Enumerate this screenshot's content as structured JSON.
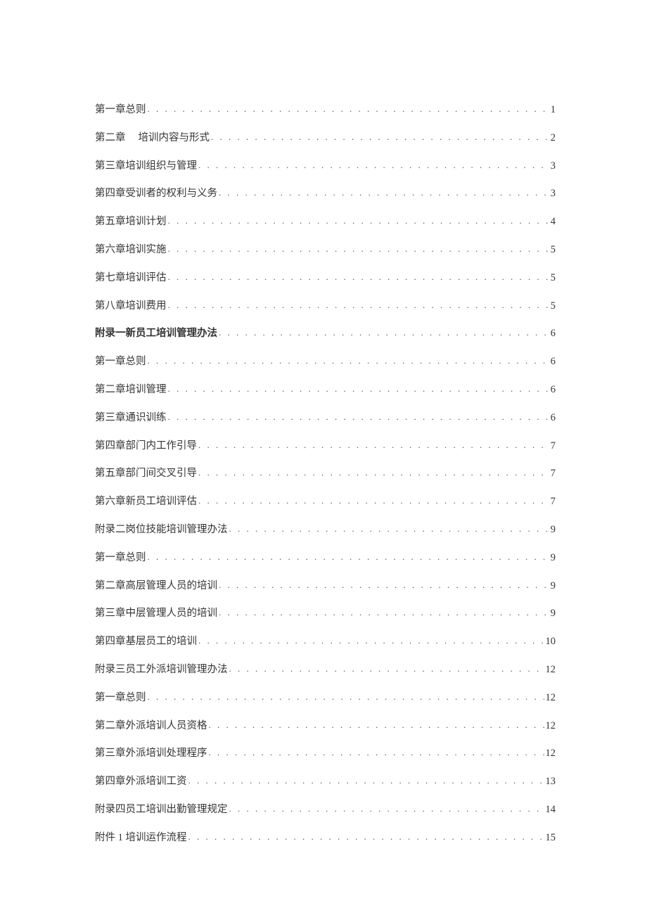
{
  "toc": [
    {
      "title": "第一章总则",
      "page": "1",
      "bold": false,
      "hasSpacer": false
    },
    {
      "title": "第二章",
      "titleSuffix": "培训内容与形式",
      "page": "2",
      "bold": false,
      "hasSpacer": true
    },
    {
      "title": "第三章培训组织与管理",
      "page": "3",
      "bold": false,
      "hasSpacer": false
    },
    {
      "title": "第四章受训者的权利与义务",
      "page": "3",
      "bold": false,
      "hasSpacer": false
    },
    {
      "title": "第五章培训计划",
      "page": "4",
      "bold": false,
      "hasSpacer": false
    },
    {
      "title": "第六章培训实施",
      "page": "5",
      "bold": false,
      "hasSpacer": false
    },
    {
      "title": "第七章培训评估",
      "page": "5",
      "bold": false,
      "hasSpacer": false
    },
    {
      "title": "第八章培训费用",
      "page": "5",
      "bold": false,
      "hasSpacer": false
    },
    {
      "title": "附录一新员工培训管理办法",
      "page": "6",
      "bold": true,
      "hasSpacer": false
    },
    {
      "title": "第一章总则",
      "page": "6",
      "bold": false,
      "hasSpacer": false
    },
    {
      "title": "第二章培训管理",
      "page": "6",
      "bold": false,
      "hasSpacer": false
    },
    {
      "title": "第三章通识训练",
      "page": "6",
      "bold": false,
      "hasSpacer": false
    },
    {
      "title": "第四章部门内工作引导",
      "page": "7",
      "bold": false,
      "hasSpacer": false
    },
    {
      "title": "第五章部门间交叉引导",
      "page": "7",
      "bold": false,
      "hasSpacer": false
    },
    {
      "title": "第六章新员工培训评估",
      "page": "7",
      "bold": false,
      "hasSpacer": false
    },
    {
      "title": "附录二岗位技能培训管理办法",
      "page": "9",
      "bold": false,
      "hasSpacer": false
    },
    {
      "title": "第一章总则",
      "page": "9",
      "bold": false,
      "hasSpacer": false
    },
    {
      "title": "第二章高层管理人员的培训",
      "page": "9",
      "bold": false,
      "hasSpacer": false
    },
    {
      "title": "第三章中层管理人员的培训",
      "page": "9",
      "bold": false,
      "hasSpacer": false
    },
    {
      "title": "第四章基层员工的培训",
      "page": "10",
      "bold": false,
      "hasSpacer": false
    },
    {
      "title": "附录三员工外派培训管理办法",
      "page": "12",
      "bold": false,
      "hasSpacer": false
    },
    {
      "title": "第一章总则",
      "page": "12",
      "bold": false,
      "hasSpacer": false
    },
    {
      "title": "第二章外派培训人员资格",
      "page": "12",
      "bold": false,
      "hasSpacer": false
    },
    {
      "title": "第三章外派培训处理程序",
      "page": "12",
      "bold": false,
      "hasSpacer": false
    },
    {
      "title": "第四章外派培训工资",
      "page": "13",
      "bold": false,
      "hasSpacer": false
    },
    {
      "title": "附录四员工培训出勤管理规定",
      "page": "14",
      "bold": false,
      "hasSpacer": false
    },
    {
      "title": "附件 1 培训运作流程",
      "page": "15",
      "bold": false,
      "hasSpacer": false
    }
  ],
  "dotLeader": ". . . . . . . . . . . . . . . . . . . . . . . . . . . . . . . . . . . . . . . . . . . . . . . . . . . . . . . . . . . . . . . . . . . . . . . . . . . . . . . . . . . . . . . . . . . . . . . . . . . . . . . . . . . . . ."
}
